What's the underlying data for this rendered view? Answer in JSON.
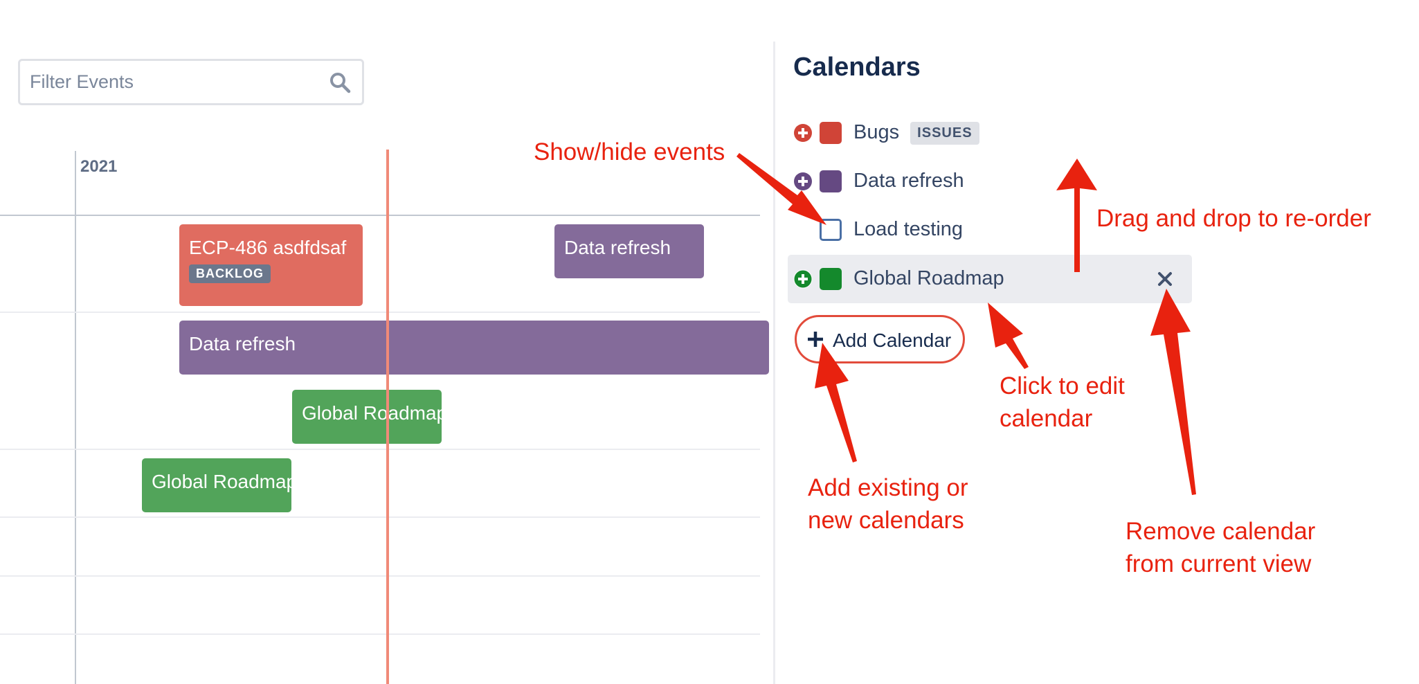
{
  "filter": {
    "placeholder": "Filter Events"
  },
  "timeline": {
    "year": "2021",
    "events": [
      {
        "label": "ECP-486 asdfdsaf",
        "badge": "BACKLOG"
      },
      {
        "label": "Data refresh"
      },
      {
        "label": "Data refresh"
      },
      {
        "label": "Global Roadmap"
      },
      {
        "label": "Global Roadmap"
      }
    ]
  },
  "panel": {
    "title": "Calendars",
    "calendars": [
      {
        "label": "Bugs",
        "lozenge": "ISSUES",
        "color": "#d04437"
      },
      {
        "label": "Data refresh",
        "color": "#654982"
      },
      {
        "label": "Load testing",
        "color": "#ffffff"
      },
      {
        "label": "Global Roadmap",
        "color": "#14892c"
      }
    ],
    "add_button_label": "Add Calendar"
  },
  "annotations": {
    "show_hide": "Show/hide events",
    "drag_drop": "Drag and drop to re-order",
    "click_edit_1": "Click to edit",
    "click_edit_2": "calendar",
    "add_existing_1": "Add existing or",
    "add_existing_2": "new calendars",
    "remove_1": "Remove calendar",
    "remove_2": "from current view"
  },
  "colors": {
    "annotation": "#e8220f",
    "today_line": "#f08a78",
    "event_red": "#e06c60",
    "event_purple": "#846b9a",
    "event_green": "#52a45a"
  },
  "icons": [
    "search-icon",
    "plus-circle-icon",
    "close-icon",
    "plus-icon"
  ]
}
